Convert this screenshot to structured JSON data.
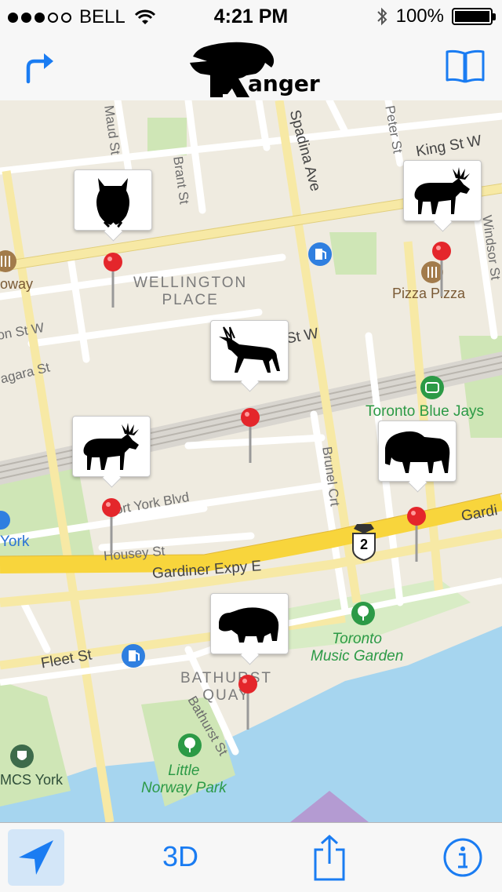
{
  "status_bar": {
    "carrier": "BELL",
    "signal_bars_filled": 3,
    "signal_bars_total": 5,
    "time": "4:21 PM",
    "battery": "100%",
    "battery_level": 1.0
  },
  "nav_bar": {
    "logo_text": "Ranger",
    "left_icon": "directions-arrow-icon",
    "right_icon": "bookmarks-book-icon"
  },
  "map": {
    "streets": {
      "maud": "Maud St",
      "brant": "Brant St",
      "spadina": "Spadina Ave",
      "peter": "Peter St",
      "king": "King St W",
      "windsor": "Windsor St",
      "wellington_w": "on St W",
      "niagara": "agara St",
      "front": "nt St W",
      "fort_york": "Fort York Blvd",
      "housey": "Housey St",
      "gardiner": "Gardiner Expy E",
      "gardiner_right": "Gardi",
      "brunel": "Brunel Crt",
      "fleet": "Fleet St",
      "bathurst_st": "Bathurst St"
    },
    "places": {
      "wellington_place": "WELLINGTON\nPLACE",
      "pizza_pizza": "Pizza Pizza",
      "subway": "oway",
      "blue_jays": "Toronto Blue Jays",
      "york": "York",
      "music_garden": "Toronto\nMusic Garden",
      "bathurst_quay": "BATHURST\nQUAY",
      "little_norway": "Little\nNorway Park",
      "hmcs_york": "MCS York"
    },
    "highway_shield": "2",
    "animals": [
      "owl",
      "moose",
      "antelope",
      "moose",
      "bison",
      "hippo"
    ]
  },
  "toolbar": {
    "location_icon": "location-arrow-icon",
    "three_d_label": "3D",
    "share_icon": "share-icon",
    "info_icon": "info-icon"
  },
  "colors": {
    "accent": "#1a7cf2",
    "map_land": "#efebe0",
    "water": "#a6d5ef",
    "park": "#cfe6b6",
    "highway": "#f8d53c",
    "major_road": "#f7e9a5",
    "pin_red": "#e4262b",
    "place_green": "#2c9a46"
  }
}
